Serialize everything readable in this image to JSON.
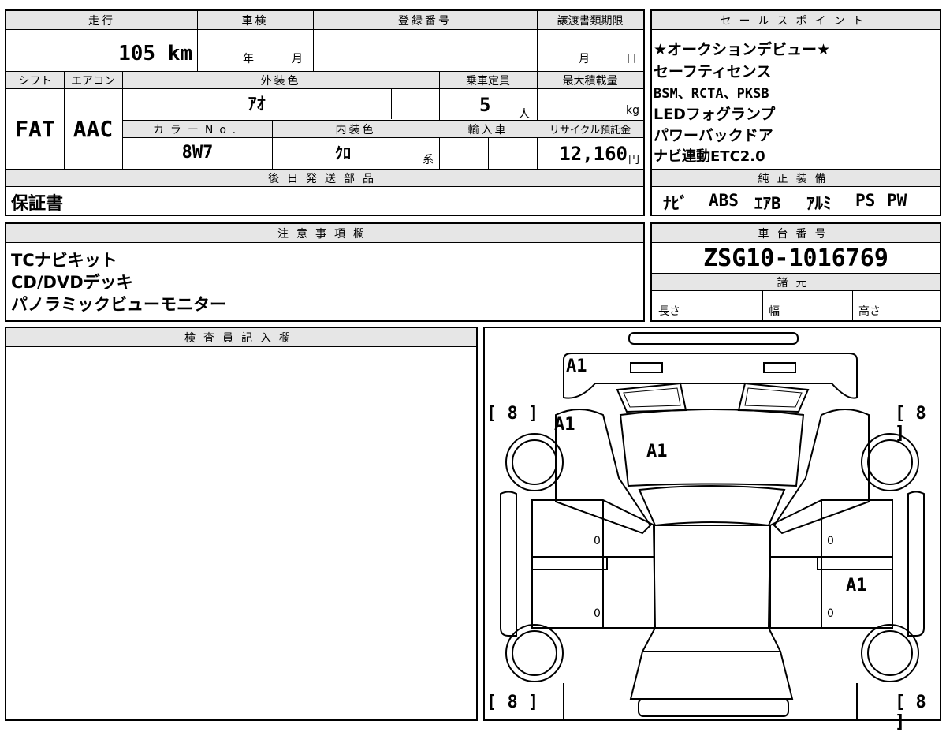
{
  "top_info": {
    "headers": {
      "mileage": "走行",
      "inspection": "車検",
      "registration": "登録番号",
      "transfer_deadline": "譲渡書類期限"
    },
    "mileage_value": "105 km",
    "inspection_year_unit": "年",
    "inspection_month_unit": "月",
    "transfer_month_unit": "月",
    "transfer_day_unit": "日"
  },
  "row2": {
    "headers": {
      "shift": "シフト",
      "aircon": "エアコン",
      "exterior_color": "外装色",
      "capacity": "乗車定員",
      "max_load": "最大積載量",
      "color_no": "カラーNo.",
      "interior_color": "内装色",
      "import": "輸入車",
      "recycle": "リサイクル預託金"
    },
    "shift_value": "FAT",
    "aircon_value": "AAC",
    "exterior_color_value": "ｱｵ",
    "capacity_value": "5",
    "capacity_unit": "人",
    "max_load_unit": "kg",
    "color_no_value": "8W7",
    "interior_color_value": "ｸﾛ",
    "interior_color_suffix": "系",
    "recycle_value": "12,160",
    "recycle_unit": "円"
  },
  "later_parts": {
    "header": "後日発送部品",
    "value": "保証書"
  },
  "sales_points": {
    "header": "セールスポイント",
    "lines": [
      "★オークションデビュー★",
      "セーフティセンス",
      "BSM、RCTA、PKSB",
      "LEDフォグランプ",
      "パワーバックドア",
      "ナビ連動ETC2.0"
    ]
  },
  "genuine_equipment": {
    "header": "純正装備",
    "items": [
      "ﾅﾋﾞ",
      "ABS",
      "ｴｱB",
      "ｱﾙﾐ",
      "PS",
      "PW"
    ]
  },
  "notes": {
    "header": "注意事項欄",
    "lines": [
      "TCナビキット",
      "CD/DVDデッキ",
      "パノラミックビューモニター"
    ]
  },
  "chassis": {
    "header": "車台番号",
    "value": "ZSG10-1016769",
    "spec_header": "諸元",
    "length_label": "長さ",
    "width_label": "幅",
    "height_label": "高さ"
  },
  "inspector": {
    "header": "検査員記入欄"
  },
  "diagram": {
    "tire_fl": "[ 8 ]",
    "tire_fr": "[ 8 ]",
    "tire_rl": "[ 8 ]",
    "tire_rr": "[ 8 ]",
    "mark_front_bumper": "A1",
    "mark_left_fender": "A1",
    "mark_hood": "A1",
    "mark_right_rear_door": "A1",
    "door_left_front": "0",
    "door_left_rear": "0",
    "door_right_front": "0",
    "door_right_rear": "0"
  }
}
